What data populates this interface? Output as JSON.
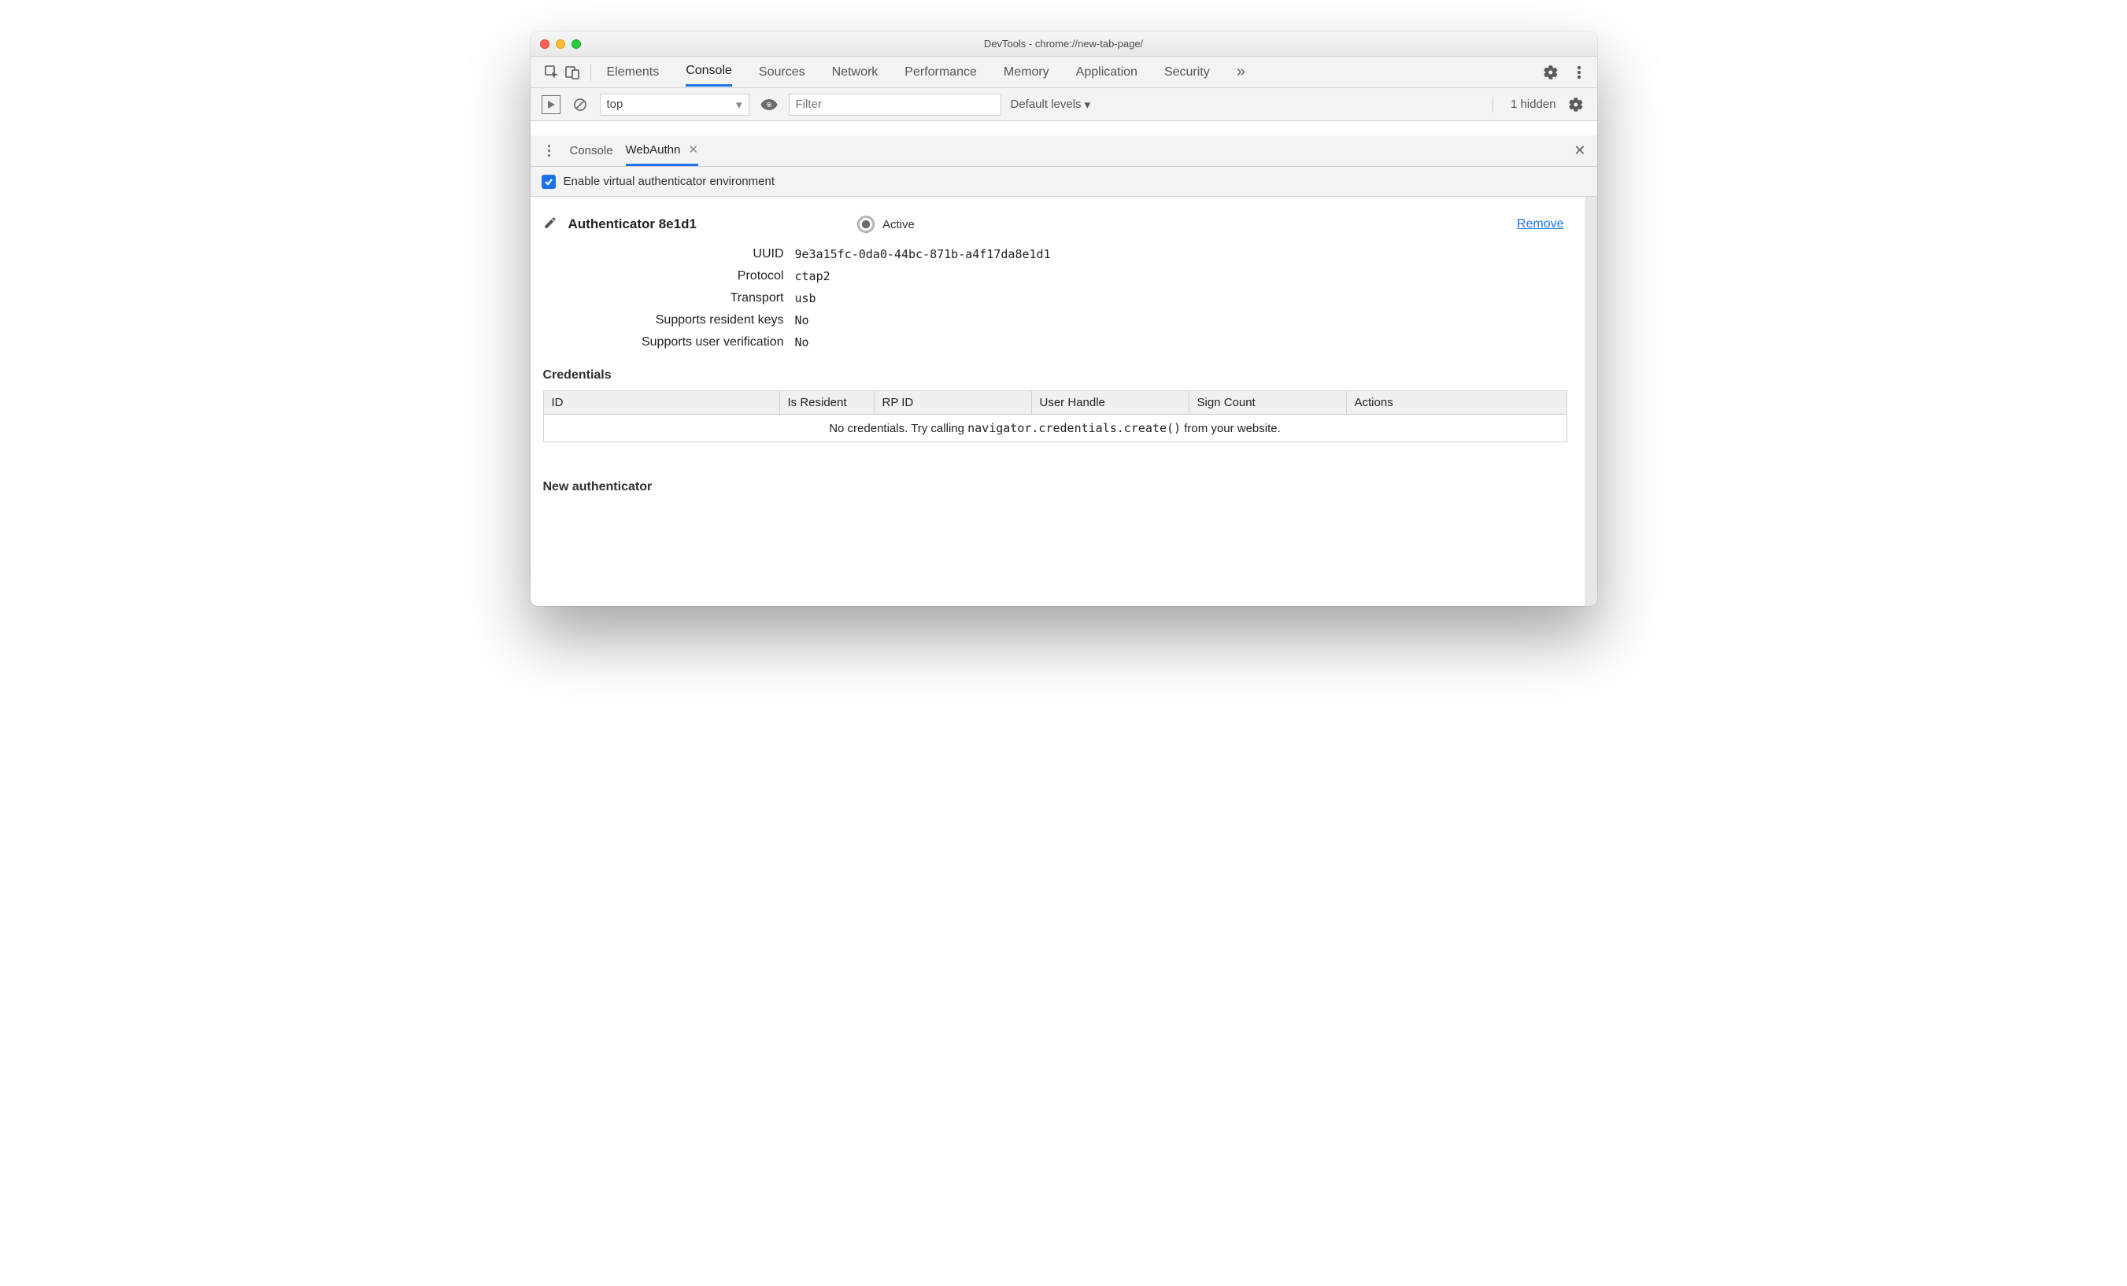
{
  "window": {
    "title": "DevTools - chrome://new-tab-page/"
  },
  "toolbar": {
    "tabs": [
      "Elements",
      "Console",
      "Sources",
      "Network",
      "Performance",
      "Memory",
      "Application",
      "Security"
    ],
    "active_tab": "Console",
    "more_glyph": "»"
  },
  "console_bar": {
    "context": "top",
    "filter_placeholder": "Filter",
    "levels_label": "Default levels",
    "levels_caret": "▾",
    "hidden_label": "1 hidden"
  },
  "drawer": {
    "tabs": [
      {
        "label": "Console",
        "active": false,
        "closable": false
      },
      {
        "label": "WebAuthn",
        "active": true,
        "closable": true
      }
    ],
    "close_glyph": "✕"
  },
  "enable": {
    "label": "Enable virtual authenticator environment",
    "checked": true
  },
  "authenticator": {
    "title": "Authenticator 8e1d1",
    "active_label": "Active",
    "remove_label": "Remove",
    "props": {
      "uuid_label": "UUID",
      "uuid": "9e3a15fc-0da0-44bc-871b-a4f17da8e1d1",
      "protocol_label": "Protocol",
      "protocol": "ctap2",
      "transport_label": "Transport",
      "transport": "usb",
      "srk_label": "Supports resident keys",
      "srk": "No",
      "suv_label": "Supports user verification",
      "suv": "No"
    }
  },
  "credentials": {
    "title": "Credentials",
    "columns": [
      "ID",
      "Is Resident",
      "RP ID",
      "User Handle",
      "Sign Count",
      "Actions"
    ],
    "empty_prefix": "No credentials. Try calling ",
    "empty_code": "navigator.credentials.create()",
    "empty_suffix": " from your website."
  },
  "new_auth": {
    "title": "New authenticator"
  }
}
